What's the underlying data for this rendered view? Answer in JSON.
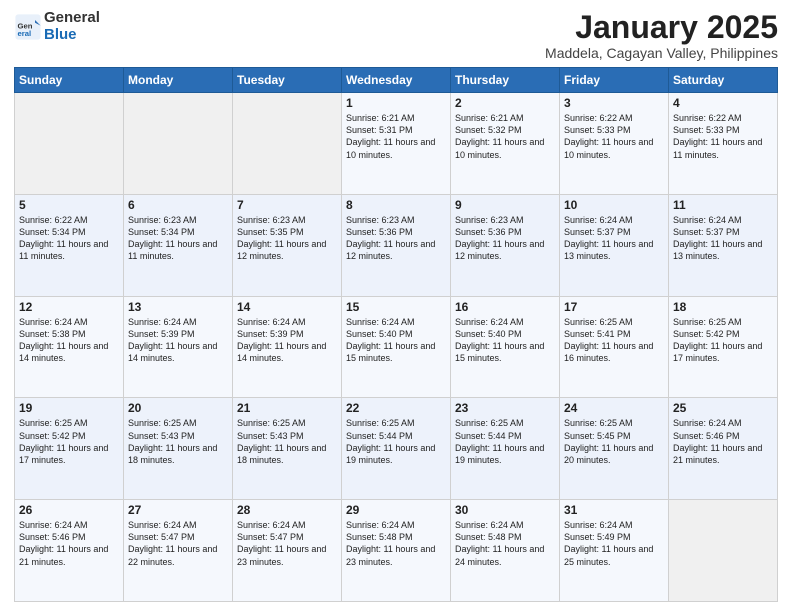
{
  "logo": {
    "general": "General",
    "blue": "Blue"
  },
  "header": {
    "title": "January 2025",
    "subtitle": "Maddela, Cagayan Valley, Philippines"
  },
  "weekdays": [
    "Sunday",
    "Monday",
    "Tuesday",
    "Wednesday",
    "Thursday",
    "Friday",
    "Saturday"
  ],
  "weeks": [
    [
      {
        "day": "",
        "sunrise": "",
        "sunset": "",
        "daylight": ""
      },
      {
        "day": "",
        "sunrise": "",
        "sunset": "",
        "daylight": ""
      },
      {
        "day": "",
        "sunrise": "",
        "sunset": "",
        "daylight": ""
      },
      {
        "day": "1",
        "sunrise": "Sunrise: 6:21 AM",
        "sunset": "Sunset: 5:31 PM",
        "daylight": "Daylight: 11 hours and 10 minutes."
      },
      {
        "day": "2",
        "sunrise": "Sunrise: 6:21 AM",
        "sunset": "Sunset: 5:32 PM",
        "daylight": "Daylight: 11 hours and 10 minutes."
      },
      {
        "day": "3",
        "sunrise": "Sunrise: 6:22 AM",
        "sunset": "Sunset: 5:33 PM",
        "daylight": "Daylight: 11 hours and 10 minutes."
      },
      {
        "day": "4",
        "sunrise": "Sunrise: 6:22 AM",
        "sunset": "Sunset: 5:33 PM",
        "daylight": "Daylight: 11 hours and 11 minutes."
      }
    ],
    [
      {
        "day": "5",
        "sunrise": "Sunrise: 6:22 AM",
        "sunset": "Sunset: 5:34 PM",
        "daylight": "Daylight: 11 hours and 11 minutes."
      },
      {
        "day": "6",
        "sunrise": "Sunrise: 6:23 AM",
        "sunset": "Sunset: 5:34 PM",
        "daylight": "Daylight: 11 hours and 11 minutes."
      },
      {
        "day": "7",
        "sunrise": "Sunrise: 6:23 AM",
        "sunset": "Sunset: 5:35 PM",
        "daylight": "Daylight: 11 hours and 12 minutes."
      },
      {
        "day": "8",
        "sunrise": "Sunrise: 6:23 AM",
        "sunset": "Sunset: 5:36 PM",
        "daylight": "Daylight: 11 hours and 12 minutes."
      },
      {
        "day": "9",
        "sunrise": "Sunrise: 6:23 AM",
        "sunset": "Sunset: 5:36 PM",
        "daylight": "Daylight: 11 hours and 12 minutes."
      },
      {
        "day": "10",
        "sunrise": "Sunrise: 6:24 AM",
        "sunset": "Sunset: 5:37 PM",
        "daylight": "Daylight: 11 hours and 13 minutes."
      },
      {
        "day": "11",
        "sunrise": "Sunrise: 6:24 AM",
        "sunset": "Sunset: 5:37 PM",
        "daylight": "Daylight: 11 hours and 13 minutes."
      }
    ],
    [
      {
        "day": "12",
        "sunrise": "Sunrise: 6:24 AM",
        "sunset": "Sunset: 5:38 PM",
        "daylight": "Daylight: 11 hours and 14 minutes."
      },
      {
        "day": "13",
        "sunrise": "Sunrise: 6:24 AM",
        "sunset": "Sunset: 5:39 PM",
        "daylight": "Daylight: 11 hours and 14 minutes."
      },
      {
        "day": "14",
        "sunrise": "Sunrise: 6:24 AM",
        "sunset": "Sunset: 5:39 PM",
        "daylight": "Daylight: 11 hours and 14 minutes."
      },
      {
        "day": "15",
        "sunrise": "Sunrise: 6:24 AM",
        "sunset": "Sunset: 5:40 PM",
        "daylight": "Daylight: 11 hours and 15 minutes."
      },
      {
        "day": "16",
        "sunrise": "Sunrise: 6:24 AM",
        "sunset": "Sunset: 5:40 PM",
        "daylight": "Daylight: 11 hours and 15 minutes."
      },
      {
        "day": "17",
        "sunrise": "Sunrise: 6:25 AM",
        "sunset": "Sunset: 5:41 PM",
        "daylight": "Daylight: 11 hours and 16 minutes."
      },
      {
        "day": "18",
        "sunrise": "Sunrise: 6:25 AM",
        "sunset": "Sunset: 5:42 PM",
        "daylight": "Daylight: 11 hours and 17 minutes."
      }
    ],
    [
      {
        "day": "19",
        "sunrise": "Sunrise: 6:25 AM",
        "sunset": "Sunset: 5:42 PM",
        "daylight": "Daylight: 11 hours and 17 minutes."
      },
      {
        "day": "20",
        "sunrise": "Sunrise: 6:25 AM",
        "sunset": "Sunset: 5:43 PM",
        "daylight": "Daylight: 11 hours and 18 minutes."
      },
      {
        "day": "21",
        "sunrise": "Sunrise: 6:25 AM",
        "sunset": "Sunset: 5:43 PM",
        "daylight": "Daylight: 11 hours and 18 minutes."
      },
      {
        "day": "22",
        "sunrise": "Sunrise: 6:25 AM",
        "sunset": "Sunset: 5:44 PM",
        "daylight": "Daylight: 11 hours and 19 minutes."
      },
      {
        "day": "23",
        "sunrise": "Sunrise: 6:25 AM",
        "sunset": "Sunset: 5:44 PM",
        "daylight": "Daylight: 11 hours and 19 minutes."
      },
      {
        "day": "24",
        "sunrise": "Sunrise: 6:25 AM",
        "sunset": "Sunset: 5:45 PM",
        "daylight": "Daylight: 11 hours and 20 minutes."
      },
      {
        "day": "25",
        "sunrise": "Sunrise: 6:24 AM",
        "sunset": "Sunset: 5:46 PM",
        "daylight": "Daylight: 11 hours and 21 minutes."
      }
    ],
    [
      {
        "day": "26",
        "sunrise": "Sunrise: 6:24 AM",
        "sunset": "Sunset: 5:46 PM",
        "daylight": "Daylight: 11 hours and 21 minutes."
      },
      {
        "day": "27",
        "sunrise": "Sunrise: 6:24 AM",
        "sunset": "Sunset: 5:47 PM",
        "daylight": "Daylight: 11 hours and 22 minutes."
      },
      {
        "day": "28",
        "sunrise": "Sunrise: 6:24 AM",
        "sunset": "Sunset: 5:47 PM",
        "daylight": "Daylight: 11 hours and 23 minutes."
      },
      {
        "day": "29",
        "sunrise": "Sunrise: 6:24 AM",
        "sunset": "Sunset: 5:48 PM",
        "daylight": "Daylight: 11 hours and 23 minutes."
      },
      {
        "day": "30",
        "sunrise": "Sunrise: 6:24 AM",
        "sunset": "Sunset: 5:48 PM",
        "daylight": "Daylight: 11 hours and 24 minutes."
      },
      {
        "day": "31",
        "sunrise": "Sunrise: 6:24 AM",
        "sunset": "Sunset: 5:49 PM",
        "daylight": "Daylight: 11 hours and 25 minutes."
      },
      {
        "day": "",
        "sunrise": "",
        "sunset": "",
        "daylight": ""
      }
    ]
  ]
}
